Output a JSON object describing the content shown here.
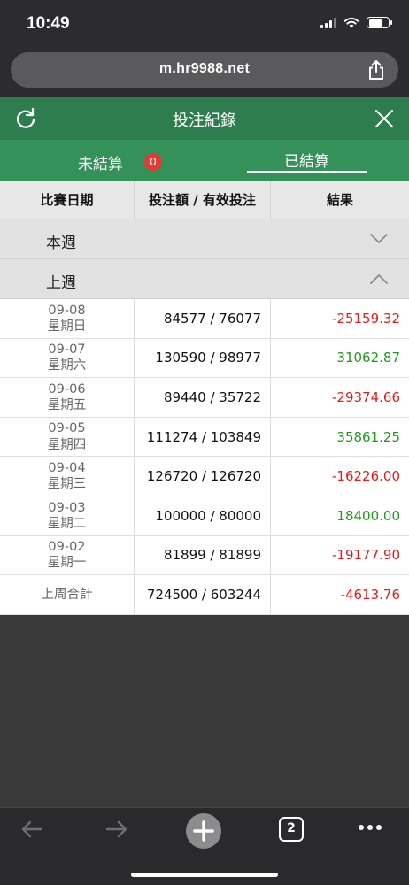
{
  "status_bar": {
    "time": "10:49"
  },
  "browser": {
    "url": "m.hr9988.net",
    "tab_count": "2"
  },
  "header": {
    "title": "投注紀錄"
  },
  "tabs": {
    "unsettled": {
      "label": "未結算",
      "count": "0"
    },
    "settled": {
      "label": "已結算"
    }
  },
  "table": {
    "columns": [
      "比賽日期",
      "投注額 / 有效投注",
      "結果"
    ],
    "groups": {
      "this_week": {
        "label": "本週",
        "expanded": false
      },
      "last_week": {
        "label": "上週",
        "expanded": true
      }
    },
    "rows": [
      {
        "date": "09-08",
        "weekday": "星期日",
        "amount": "84577 / 76077",
        "result": "-25159.32",
        "sign": "neg"
      },
      {
        "date": "09-07",
        "weekday": "星期六",
        "amount": "130590 / 98977",
        "result": "31062.87",
        "sign": "pos"
      },
      {
        "date": "09-06",
        "weekday": "星期五",
        "amount": "89440 / 35722",
        "result": "-29374.66",
        "sign": "neg"
      },
      {
        "date": "09-05",
        "weekday": "星期四",
        "amount": "111274 / 103849",
        "result": "35861.25",
        "sign": "pos"
      },
      {
        "date": "09-04",
        "weekday": "星期三",
        "amount": "126720 / 126720",
        "result": "-16226.00",
        "sign": "neg"
      },
      {
        "date": "09-03",
        "weekday": "星期二",
        "amount": "100000 / 80000",
        "result": "18400.00",
        "sign": "pos"
      },
      {
        "date": "09-02",
        "weekday": "星期一",
        "amount": "81899 / 81899",
        "result": "-19177.90",
        "sign": "neg"
      }
    ],
    "total": {
      "label": "上周合計",
      "amount": "724500 / 603244",
      "result": "-4613.76",
      "sign": "neg"
    }
  },
  "colors": {
    "header_green": "#2e7d4f",
    "tab_green": "#35915a",
    "negative": "#e41b1b",
    "positive": "#1e9a1e",
    "badge": "#e53935"
  },
  "icons": [
    "refresh-icon",
    "close-icon",
    "chevron-down-icon",
    "chevron-up-icon",
    "share-icon",
    "back-icon",
    "forward-icon",
    "plus-icon",
    "more-icon"
  ]
}
